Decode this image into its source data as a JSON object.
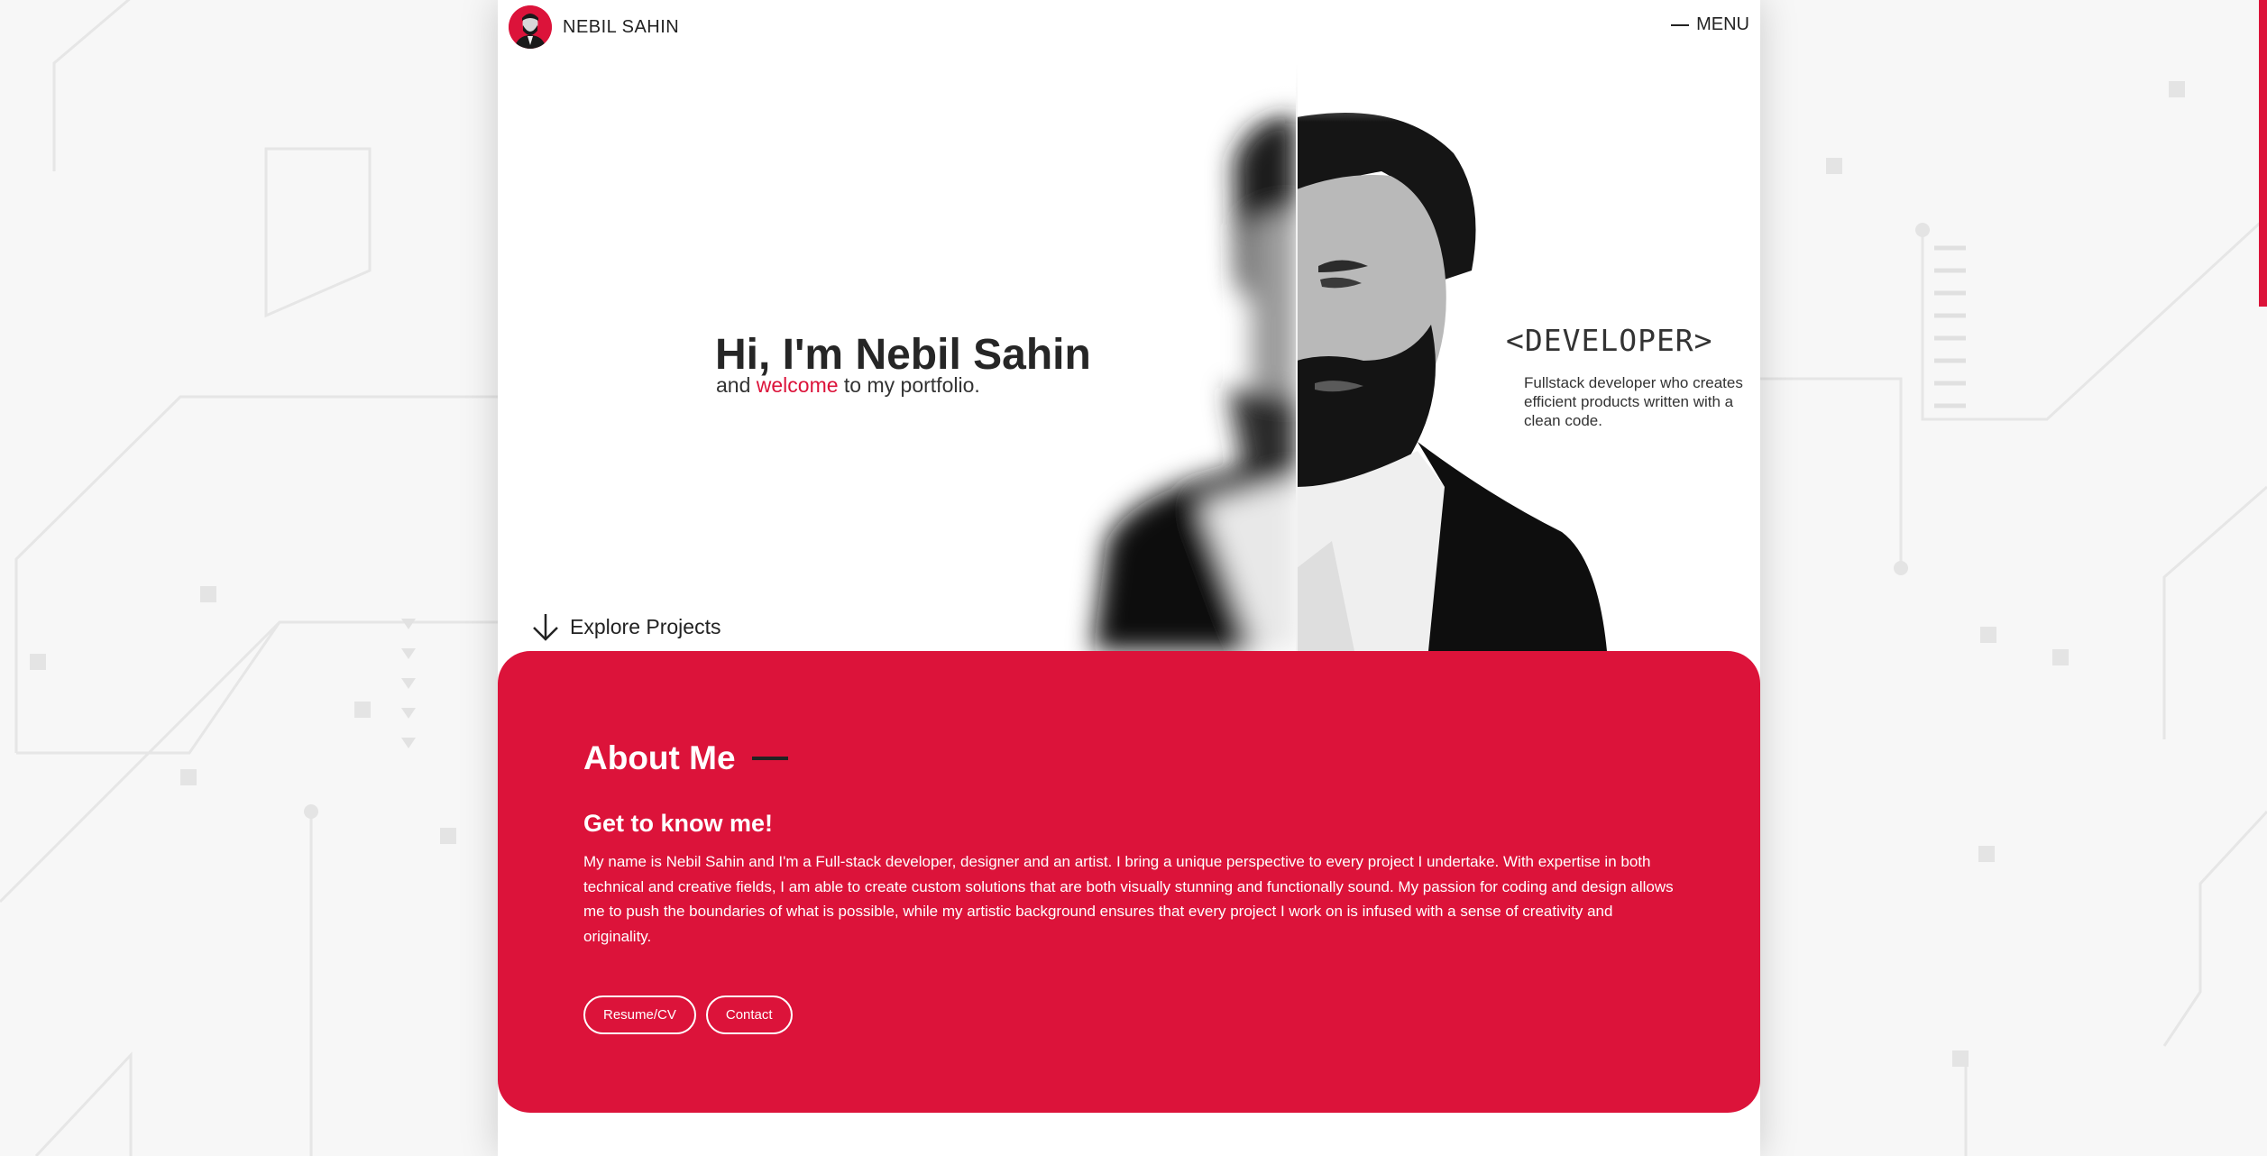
{
  "header": {
    "brand_name": "NEBIL SAHIN",
    "menu_label": "MENU"
  },
  "hero": {
    "title": "Hi, I'm Nebil Sahin",
    "subtitle_prefix": "and ",
    "subtitle_accent": "welcome",
    "subtitle_suffix": " to my portfolio.",
    "role_title": "<DEVELOPER>",
    "role_description": "Fullstack developer who creates efficient products written with a clean code.",
    "explore_label": "Explore Projects"
  },
  "about": {
    "title": "About Me",
    "subtitle": "Get to know me!",
    "text": "My name is Nebil Sahin and I'm a Full-stack developer, designer and an artist. I bring a unique perspective to every project I undertake. With expertise in both technical and creative fields, I am able to create custom solutions that are both visually stunning and functionally sound. My passion for coding and design allows me to push the boundaries of what is possible, while my artistic background ensures that every project I work on is infused with a sense of creativity and originality.",
    "buttons": {
      "resume": "Resume/CV",
      "contact": "Contact"
    }
  },
  "icons": {
    "menu": "hamburger-line-icon",
    "explore": "arrow-down-icon"
  },
  "colors": {
    "accent": "#dc133a",
    "text_dark": "#262626",
    "background": "#f7f7f7",
    "page": "#ffffff"
  }
}
